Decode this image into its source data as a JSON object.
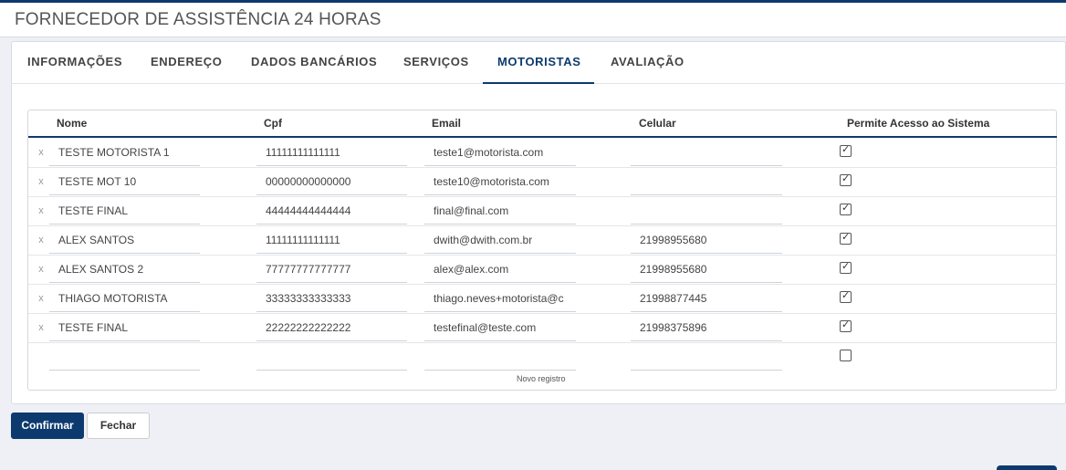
{
  "header": {
    "title": "FORNECEDOR DE ASSISTÊNCIA 24 HORAS"
  },
  "tabs": [
    {
      "label": "INFORMAÇÕES",
      "active": false
    },
    {
      "label": "ENDEREÇO",
      "active": false
    },
    {
      "label": "DADOS BANCÁRIOS",
      "active": false
    },
    {
      "label": "SERVIÇOS",
      "active": false
    },
    {
      "label": "MOTORISTAS",
      "active": true
    },
    {
      "label": "AVALIAÇÃO",
      "active": false
    }
  ],
  "grid": {
    "columns": {
      "nome": "Nome",
      "cpf": "Cpf",
      "email": "Email",
      "celular": "Celular",
      "acesso": "Permite Acesso ao Sistema"
    },
    "delete_glyph": "x",
    "check_glyph": "✓",
    "rows": [
      {
        "nome": "TESTE MOTORISTA 1",
        "cpf": "11111111111111",
        "email": "teste1@motorista.com",
        "celular": "",
        "acesso": true
      },
      {
        "nome": "TESTE MOT 10",
        "cpf": "00000000000000",
        "email": "teste10@motorista.com",
        "celular": "",
        "acesso": true
      },
      {
        "nome": "TESTE FINAL",
        "cpf": "44444444444444",
        "email": "final@final.com",
        "celular": "",
        "acesso": true
      },
      {
        "nome": "ALEX SANTOS",
        "cpf": "11111111111111",
        "email": "dwith@dwith.com.br",
        "celular": "21998955680",
        "acesso": true
      },
      {
        "nome": "ALEX SANTOS 2",
        "cpf": "77777777777777",
        "email": "alex@alex.com",
        "celular": "21998955680",
        "acesso": true
      },
      {
        "nome": "THIAGO MOTORISTA",
        "cpf": "33333333333333",
        "email": "thiago.neves+motorista@c",
        "celular": "21998877445",
        "acesso": true
      },
      {
        "nome": "TESTE FINAL",
        "cpf": "22222222222222",
        "email": "testefinal@teste.com",
        "celular": "21998375896",
        "acesso": true
      }
    ],
    "new_row": {
      "nome": "",
      "cpf": "",
      "email": "",
      "celular": "",
      "acesso": false
    },
    "new_row_label": "Novo registro"
  },
  "buttons": {
    "confirm": "Confirmar",
    "close": "Fechar"
  },
  "colors": {
    "accent": "#0d3a6e",
    "background": "#eef0f6"
  }
}
